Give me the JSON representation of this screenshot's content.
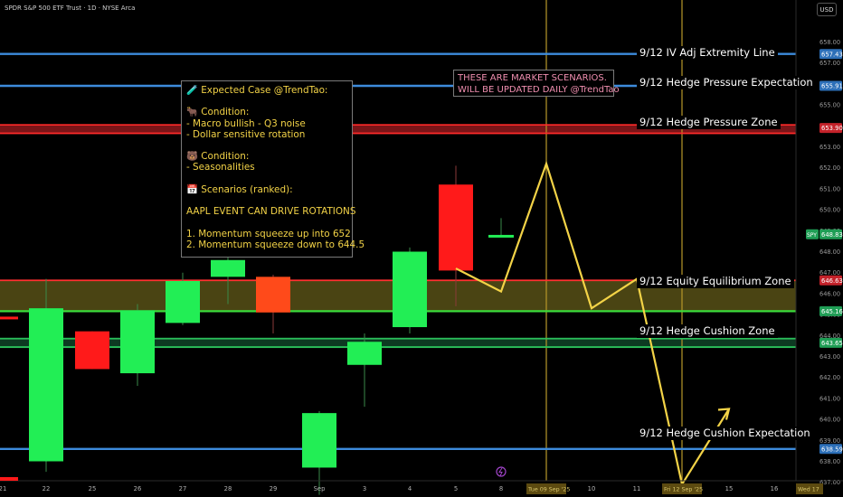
{
  "header": {
    "symbol_title": "SPDR S&P 500 ETF Trust · 1D · NYSE Arca",
    "currency_button": "USD"
  },
  "price_axis": {
    "ticks": [
      "658.00",
      "657.00",
      "656.00",
      "655.00",
      "654.00",
      "653.00",
      "652.00",
      "651.00",
      "650.00",
      "649.00",
      "648.00",
      "647.00",
      "646.00",
      "645.00",
      "644.00",
      "643.00",
      "642.00",
      "641.00",
      "640.00",
      "639.00",
      "638.00",
      "637.00"
    ],
    "badges": [
      {
        "text": "657.43",
        "color": "#2c6fb8"
      },
      {
        "text": "655.91",
        "color": "#2c6fb8"
      },
      {
        "text": "653.90",
        "color": "#c4222a"
      },
      {
        "text": "648.83",
        "color": "#1f9d55",
        "tag": "SPY"
      },
      {
        "text": "646.63",
        "color": "#c4222a"
      },
      {
        "text": "645.16",
        "color": "#1f9d55"
      },
      {
        "text": "643.65",
        "color": "#1f9d55"
      },
      {
        "text": "638.59",
        "color": "#2c6fb8"
      }
    ]
  },
  "time_axis": {
    "ticks": [
      "21",
      "22",
      "25",
      "26",
      "27",
      "28",
      "29",
      "Sep",
      "3",
      "4",
      "5",
      "8",
      "10",
      "11",
      "15",
      "16"
    ],
    "highlighted": [
      "Tue 09 Sep '25",
      "Fri 12 Sep '25",
      "Wed 17"
    ]
  },
  "levels": [
    {
      "label": "9/12 IV Adj Extremity Line",
      "price": 657.43
    },
    {
      "label": "9/12 Hedge Pressure Expectation",
      "price": 655.91
    },
    {
      "label": "9/12 Hedge Pressure Zone",
      "price": 653.9
    },
    {
      "label": "9/12 Equity Equilibrium Zone",
      "price": 646.63
    },
    {
      "label": "9/12 Hedge Cushion Zone",
      "price": 643.65
    },
    {
      "label": "9/12 Hedge Cushion Expectation",
      "price": 638.59
    }
  ],
  "note": {
    "lines": [
      "🧪 Expected Case @TrendTao:",
      "",
      "🐂 Condition:",
      "- Macro bullish - Q3 noise",
      "- Dollar sensitive rotation",
      "",
      "🐻 Condition:",
      "- Seasonalities",
      "",
      "📅 Scenarios (ranked):",
      "",
      "AAPL EVENT CAN DRIVE ROTATIONS",
      "",
      "1. Momentum squeeze up into 652",
      "2. Momentum squeeze down to 644.5"
    ]
  },
  "scenario_box": {
    "lines": [
      "THESE ARE MARKET SCENARIOS.",
      "WILL BE UPDATED DAILY @TrendTao"
    ]
  },
  "chart_data": {
    "type": "candlestick",
    "symbol": "SPY",
    "timeframe": "1D",
    "ylim": [
      636.4,
      659.0
    ],
    "candles": [
      {
        "date": "21",
        "open": 644.9,
        "high": 644.9,
        "low": 644.9,
        "close": 644.9,
        "color": "red"
      },
      {
        "date": "22",
        "open": 638.0,
        "high": 646.7,
        "low": 637.5,
        "close": 645.3,
        "color": "green"
      },
      {
        "date": "25",
        "open": 644.2,
        "high": 644.2,
        "low": 642.4,
        "close": 642.4,
        "color": "red"
      },
      {
        "date": "26",
        "open": 642.2,
        "high": 645.5,
        "low": 641.6,
        "close": 645.2,
        "color": "green"
      },
      {
        "date": "27",
        "open": 644.6,
        "high": 647.0,
        "low": 644.5,
        "close": 646.6,
        "color": "green"
      },
      {
        "date": "28",
        "open": 646.8,
        "high": 647.8,
        "low": 645.5,
        "close": 647.6,
        "color": "green"
      },
      {
        "date": "29",
        "open": 646.8,
        "high": 646.9,
        "low": 644.1,
        "close": 645.1,
        "color": "red"
      },
      {
        "date": "Sep 2",
        "open": 637.7,
        "high": 640.4,
        "low": 636.4,
        "close": 640.3,
        "color": "green"
      },
      {
        "date": "3",
        "open": 642.6,
        "high": 644.1,
        "low": 640.6,
        "close": 643.7,
        "color": "green"
      },
      {
        "date": "4",
        "open": 644.4,
        "high": 648.2,
        "low": 644.1,
        "close": 648.0,
        "color": "green"
      },
      {
        "date": "5",
        "open": 651.2,
        "high": 652.1,
        "low": 645.4,
        "close": 647.1,
        "color": "red"
      },
      {
        "date": "8",
        "open": 648.7,
        "high": 649.6,
        "low": 648.7,
        "close": 648.8,
        "color": "green"
      }
    ],
    "scenario_path_prices": [
      647.2,
      646.1,
      652.2,
      645.3,
      646.7,
      636.9,
      640.5
    ],
    "annotations": [
      "THESE ARE MARKET SCENARIOS.",
      "WILL BE UPDATED DAILY @TrendTao"
    ]
  }
}
